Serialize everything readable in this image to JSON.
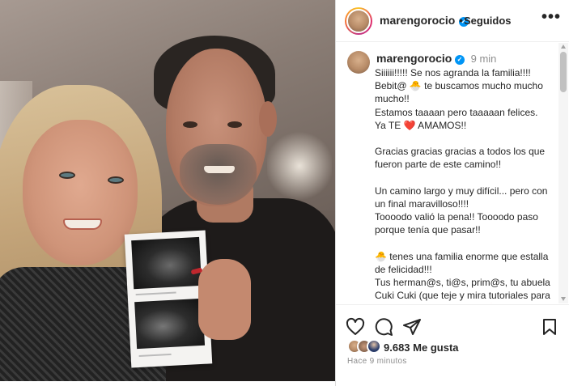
{
  "post": {
    "username": "marengorocio",
    "verified_mark": "✓",
    "separator": "•",
    "follow_status": "Seguidos",
    "more_label": "•••",
    "time_short": "9 min",
    "caption": [
      "Siiiiii!!!!! Se nos agranda la familia!!!!",
      "Bebit@ 🐣 te buscamos mucho mucho mucho!!",
      "Estamos taaaan pero taaaaan felices.",
      "Ya TE ❤️ AMAMOS!!",
      "",
      "Gracias gracias gracias a todos los que fueron parte de este camino!!",
      "",
      "Un camino largo y muy difícil... pero con un final maravilloso!!!!",
      "Toooodo valió la pena!! Toooodo paso porque tenía que pasar!!",
      "",
      "🐣 tenes una familia enorme que estalla de felicidad!!!",
      "Tus herman@s, ti@s, prim@s, tu abuela Cuki Cuki (que teje y mira tutoriales para hacerte el mejor saquito 🥰) y los"
    ],
    "likes_count": "9.683",
    "likes_label": "Me gusta",
    "time_ago": "Hace 9 minutos"
  },
  "icons": {
    "like": "heart-outline-icon",
    "comment": "comment-bubble-icon",
    "share": "paper-plane-icon",
    "save": "bookmark-icon",
    "more": "more-options-icon"
  },
  "colors": {
    "verified_blue": "#0095f6",
    "text": "#262626",
    "muted": "#8e8e8e"
  }
}
